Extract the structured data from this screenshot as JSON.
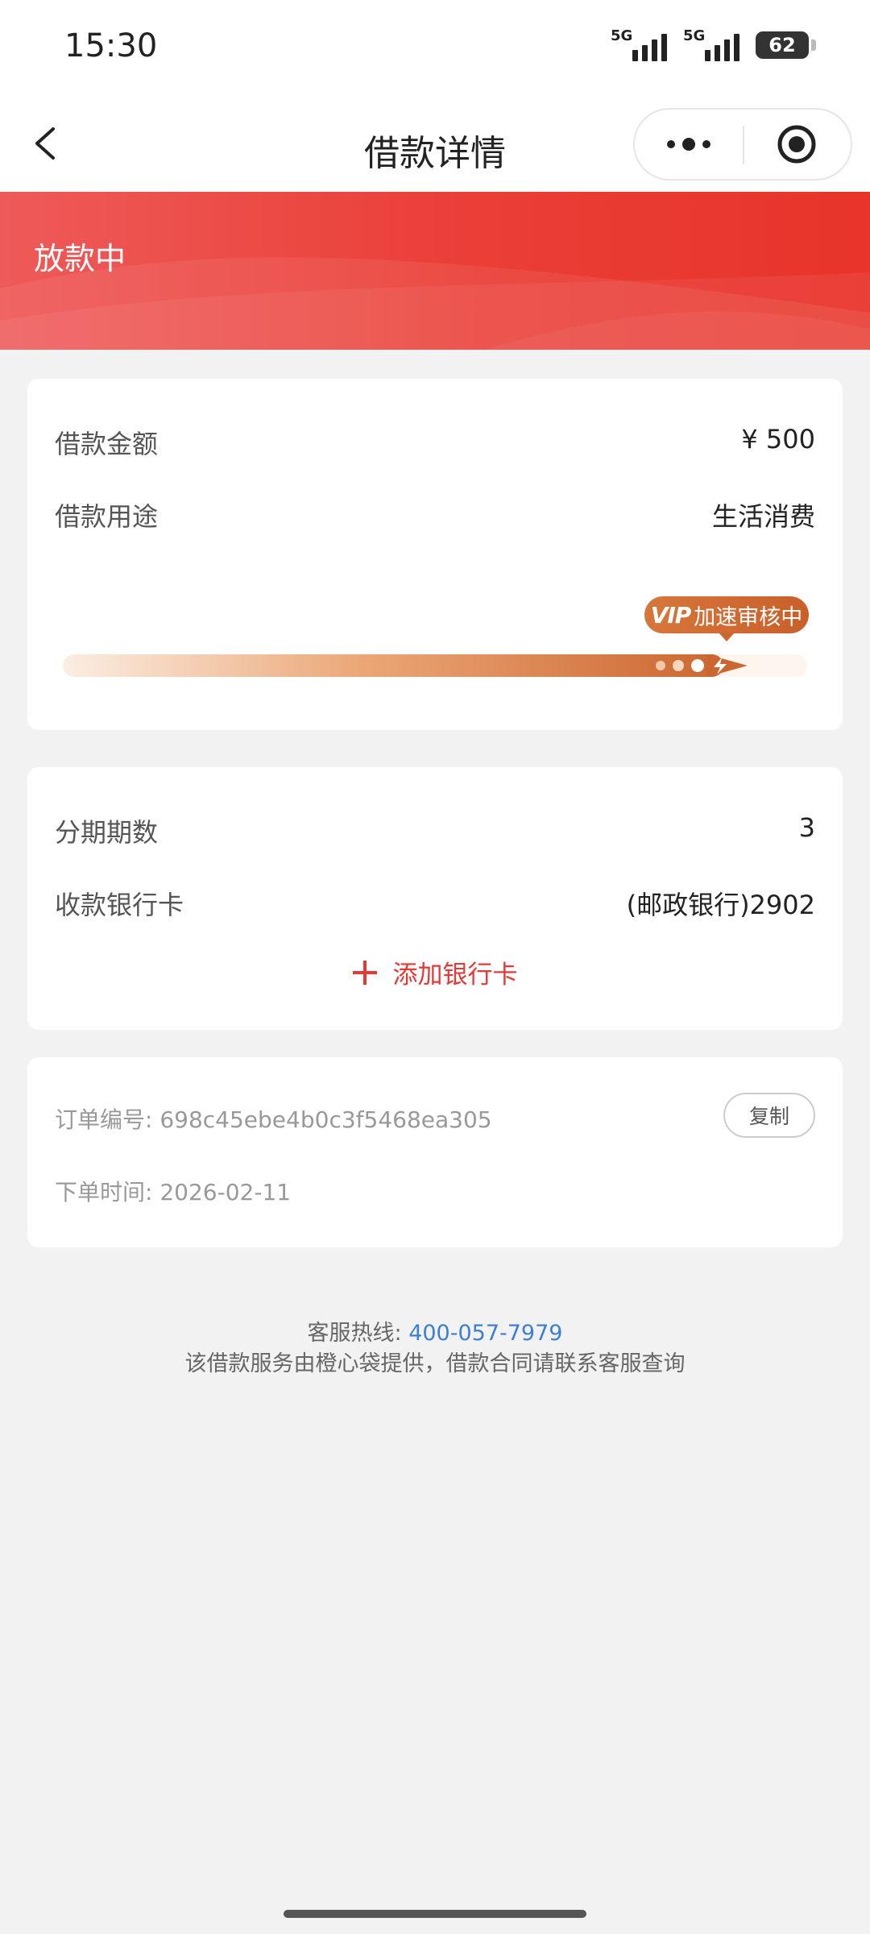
{
  "status_bar": {
    "time": "15:30",
    "signal_1": "5G",
    "signal_2": "5G",
    "battery": "62"
  },
  "nav": {
    "title": "借款详情",
    "back_icon": "chevron-left-icon",
    "more_icon": "more-dots-icon",
    "close_icon": "target-circle-icon"
  },
  "banner": {
    "status": "放款中"
  },
  "loan": {
    "amount_label": "借款金额",
    "amount_value": "¥ 500",
    "purpose_label": "借款用途",
    "purpose_value": "生活消费",
    "vip_prefix": "VIP",
    "vip_text": "加速审核中"
  },
  "installment": {
    "periods_label": "分期期数",
    "periods_value": "3",
    "bank_label": "收款银行卡",
    "bank_value": "(邮政银行)2902",
    "add_card": "添加银行卡"
  },
  "order": {
    "number_label": "订单编号: ",
    "number_value": "698c45ebe4b0c3f5468ea305",
    "copy_button": "复制",
    "time_label": "下单时间: ",
    "time_value": "2026-02-11"
  },
  "footer": {
    "hotline_label": "客服热线: ",
    "hotline_number": "400-057-7979",
    "notice": "该借款服务由橙心袋提供，借款合同请联系客服查询"
  },
  "colors": {
    "brand_red": "#e8342b",
    "link_blue": "#3d7fd3",
    "vip_orange": "#cc6630"
  }
}
